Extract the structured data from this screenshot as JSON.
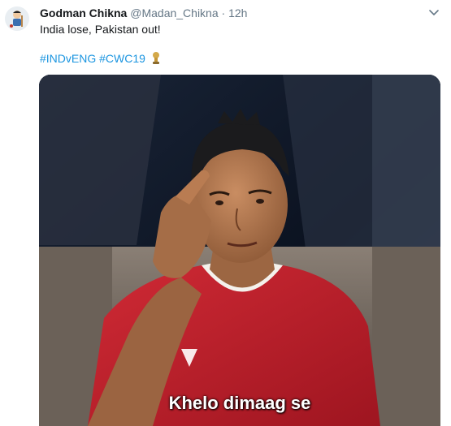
{
  "tweet": {
    "display_name": "Godman Chikna",
    "handle": "@Madan_Chikna",
    "separator": "·",
    "time": "12h",
    "text": "India lose, Pakistan out!",
    "hashtags": [
      "#INDvENG",
      "#CWC19"
    ],
    "hashtag_link_color": "#1b95e0",
    "emoji_icon": "cricket-world-cup-trophy-icon"
  },
  "media": {
    "caption": "Khelo dimaag se"
  },
  "colors": {
    "name": "#14171a",
    "meta": "#657786"
  }
}
